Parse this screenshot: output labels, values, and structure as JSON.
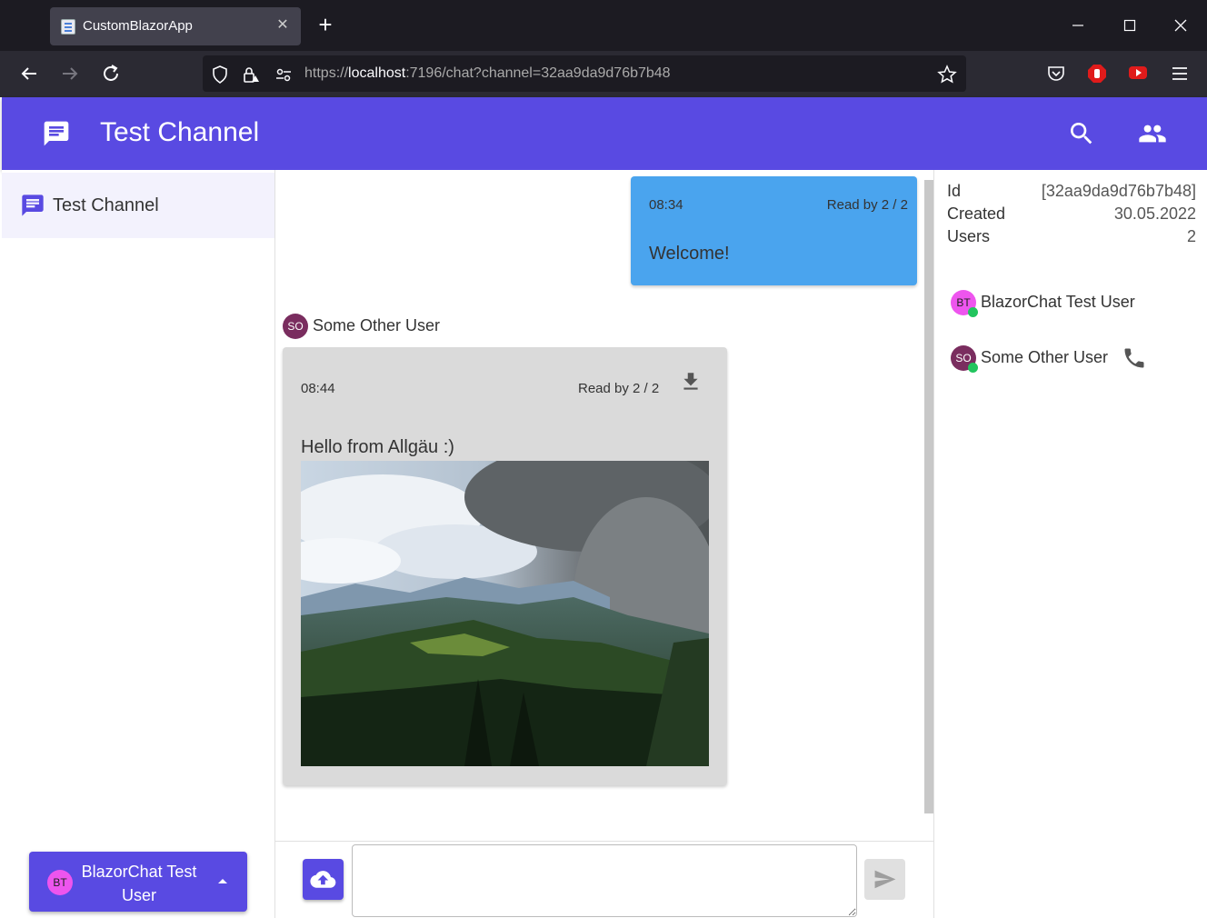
{
  "browser": {
    "tab_title": "CustomBlazorApp",
    "tab_close": "✕",
    "new_tab": "+",
    "url_scheme": "https://",
    "url_host": "localhost",
    "url_rest": ":7196/chat?channel=32aa9da9d76b7b48"
  },
  "appbar": {
    "title": "Test Channel"
  },
  "sidebar": {
    "channels": [
      {
        "label": "Test Channel"
      }
    ],
    "user_button": {
      "initials": "BT",
      "label": "BlazorChat Test User"
    }
  },
  "messages": [
    {
      "time": "08:34",
      "read": "Read by 2 / 2",
      "text": "Welcome!"
    },
    {
      "sender_initials": "SO",
      "sender": "Some Other User",
      "time": "08:44",
      "read": "Read by 2 / 2",
      "text": "Hello from Allgäu :)"
    }
  ],
  "compose": {
    "placeholder": ""
  },
  "info": {
    "rows": [
      {
        "key": "Id",
        "value": "[32aa9da9d76b7b48]"
      },
      {
        "key": "Created",
        "value": "30.05.2022"
      },
      {
        "key": "Users",
        "value": "2"
      }
    ],
    "members": [
      {
        "initials": "BT",
        "name": "BlazorChat Test User"
      },
      {
        "initials": "SO",
        "name": "Some Other User"
      }
    ]
  },
  "colors": {
    "primary": "#594ae2",
    "own_message": "#4aa4ee",
    "other_message": "#dadada",
    "online": "#22c55e"
  }
}
